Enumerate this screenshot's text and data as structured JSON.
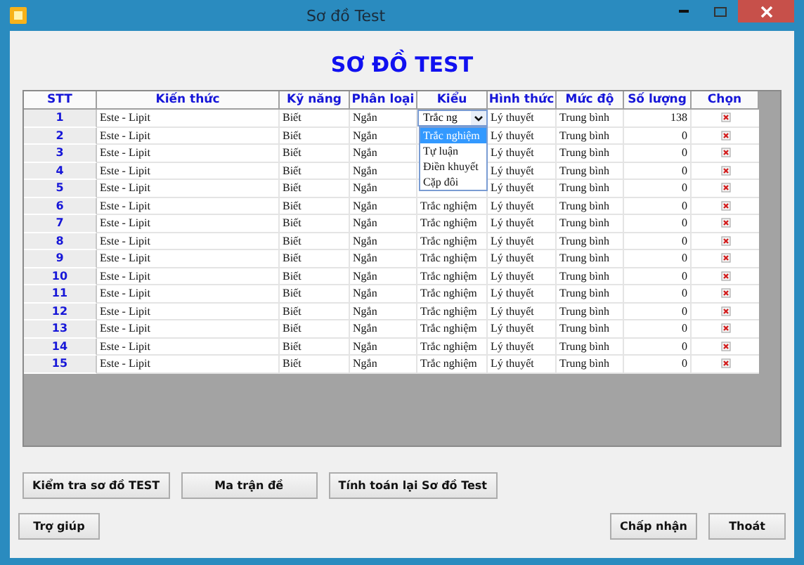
{
  "window": {
    "title": "Sơ đồ Test"
  },
  "heading": "SƠ ĐỒ TEST",
  "table": {
    "columns": [
      "STT",
      "Kiến thức",
      "Kỹ năng",
      "Phân loại",
      "Kiểu",
      "Hình thức",
      "Mức độ",
      "Số lượng",
      "Chọn"
    ],
    "rows": [
      {
        "stt": "1",
        "kien_thuc": "Este - Lipit",
        "ky_nang": "Biết",
        "phan_loai": "Ngắn",
        "kieu": "Trắc ng",
        "hinh_thuc": "Lý thuyết",
        "muc_do": "Trung bình",
        "so_luong": "138",
        "editing": true
      },
      {
        "stt": "2",
        "kien_thuc": "Este - Lipit",
        "ky_nang": "Biết",
        "phan_loai": "Ngắn",
        "hinh_thuc": "Lý thuyết",
        "muc_do": "Trung bình",
        "so_luong": "0",
        "editing": false
      },
      {
        "stt": "3",
        "kien_thuc": "Este - Lipit",
        "ky_nang": "Biết",
        "phan_loai": "Ngắn",
        "hinh_thuc": "Lý thuyết",
        "muc_do": "Trung bình",
        "so_luong": "0",
        "editing": false
      },
      {
        "stt": "4",
        "kien_thuc": "Este - Lipit",
        "ky_nang": "Biết",
        "phan_loai": "Ngắn",
        "hinh_thuc": "Lý thuyết",
        "muc_do": "Trung bình",
        "so_luong": "0",
        "editing": false
      },
      {
        "stt": "5",
        "kien_thuc": "Este - Lipit",
        "ky_nang": "Biết",
        "phan_loai": "Ngắn",
        "hinh_thuc": "Lý thuyết",
        "muc_do": "Trung bình",
        "so_luong": "0",
        "editing": false
      },
      {
        "stt": "6",
        "kien_thuc": "Este - Lipit",
        "ky_nang": "Biết",
        "phan_loai": "Ngắn",
        "kieu": "Trắc nghiệm",
        "hinh_thuc": "Lý thuyết",
        "muc_do": "Trung bình",
        "so_luong": "0",
        "editing": false
      },
      {
        "stt": "7",
        "kien_thuc": "Este - Lipit",
        "ky_nang": "Biết",
        "phan_loai": "Ngắn",
        "kieu": "Trắc nghiệm",
        "hinh_thuc": "Lý thuyết",
        "muc_do": "Trung bình",
        "so_luong": "0",
        "editing": false
      },
      {
        "stt": "8",
        "kien_thuc": "Este - Lipit",
        "ky_nang": "Biết",
        "phan_loai": "Ngắn",
        "kieu": "Trắc nghiệm",
        "hinh_thuc": "Lý thuyết",
        "muc_do": "Trung bình",
        "so_luong": "0",
        "editing": false
      },
      {
        "stt": "9",
        "kien_thuc": "Este - Lipit",
        "ky_nang": "Biết",
        "phan_loai": "Ngắn",
        "kieu": "Trắc nghiệm",
        "hinh_thuc": "Lý thuyết",
        "muc_do": "Trung bình",
        "so_luong": "0",
        "editing": false
      },
      {
        "stt": "10",
        "kien_thuc": "Este - Lipit",
        "ky_nang": "Biết",
        "phan_loai": "Ngắn",
        "kieu": "Trắc nghiệm",
        "hinh_thuc": "Lý thuyết",
        "muc_do": "Trung bình",
        "so_luong": "0",
        "editing": false
      },
      {
        "stt": "11",
        "kien_thuc": "Este - Lipit",
        "ky_nang": "Biết",
        "phan_loai": "Ngắn",
        "kieu": "Trắc nghiệm",
        "hinh_thuc": "Lý thuyết",
        "muc_do": "Trung bình",
        "so_luong": "0",
        "editing": false
      },
      {
        "stt": "12",
        "kien_thuc": "Este - Lipit",
        "ky_nang": "Biết",
        "phan_loai": "Ngắn",
        "kieu": "Trắc nghiệm",
        "hinh_thuc": "Lý thuyết",
        "muc_do": "Trung bình",
        "so_luong": "0",
        "editing": false
      },
      {
        "stt": "13",
        "kien_thuc": "Este - Lipit",
        "ky_nang": "Biết",
        "phan_loai": "Ngắn",
        "kieu": "Trắc nghiệm",
        "hinh_thuc": "Lý thuyết",
        "muc_do": "Trung bình",
        "so_luong": "0",
        "editing": false
      },
      {
        "stt": "14",
        "kien_thuc": "Este - Lipit",
        "ky_nang": "Biết",
        "phan_loai": "Ngắn",
        "kieu": "Trắc nghiệm",
        "hinh_thuc": "Lý thuyết",
        "muc_do": "Trung bình",
        "so_luong": "0",
        "editing": false
      },
      {
        "stt": "15",
        "kien_thuc": "Este - Lipit",
        "ky_nang": "Biết",
        "phan_loai": "Ngắn",
        "kieu": "Trắc nghiệm",
        "hinh_thuc": "Lý thuyết",
        "muc_do": "Trung bình",
        "so_luong": "0",
        "editing": false
      }
    ]
  },
  "dropdown": {
    "options": [
      {
        "label": "Trắc nghiệm",
        "selected": true
      },
      {
        "label": "Tự luận",
        "selected": false
      },
      {
        "label": "Điền khuyết",
        "selected": false
      },
      {
        "label": "Cặp đôi",
        "selected": false
      }
    ]
  },
  "action_buttons": [
    "Kiểm tra sơ đồ TEST",
    "Ma trận đề",
    "Tính toán lại Sơ đồ Test"
  ],
  "footer_buttons": {
    "left": [
      "Trợ giúp"
    ],
    "right": [
      "Chấp nhận",
      "Thoát"
    ]
  }
}
